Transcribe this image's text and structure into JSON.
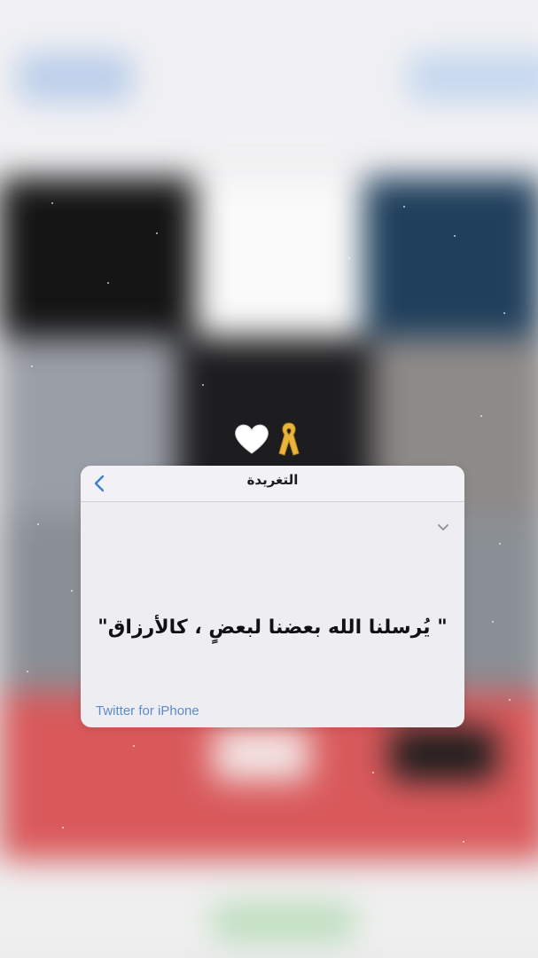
{
  "header": {
    "title": "التغريدة"
  },
  "tweet": {
    "text": "\" يُرسلنا الله بعضنا لبعضٍ ، كالأرزاق\"",
    "source": "Twitter for iPhone"
  },
  "decorations": {
    "icons": [
      "white-heart-icon",
      "yellow-ribbon-icon"
    ]
  },
  "colors": {
    "card_background": "#eeedf2",
    "header_background": "#f2f2f6",
    "accent_blue": "#3d7fd0",
    "source_link": "#5b8ccc",
    "ribbon_yellow": "#e9b53a"
  }
}
